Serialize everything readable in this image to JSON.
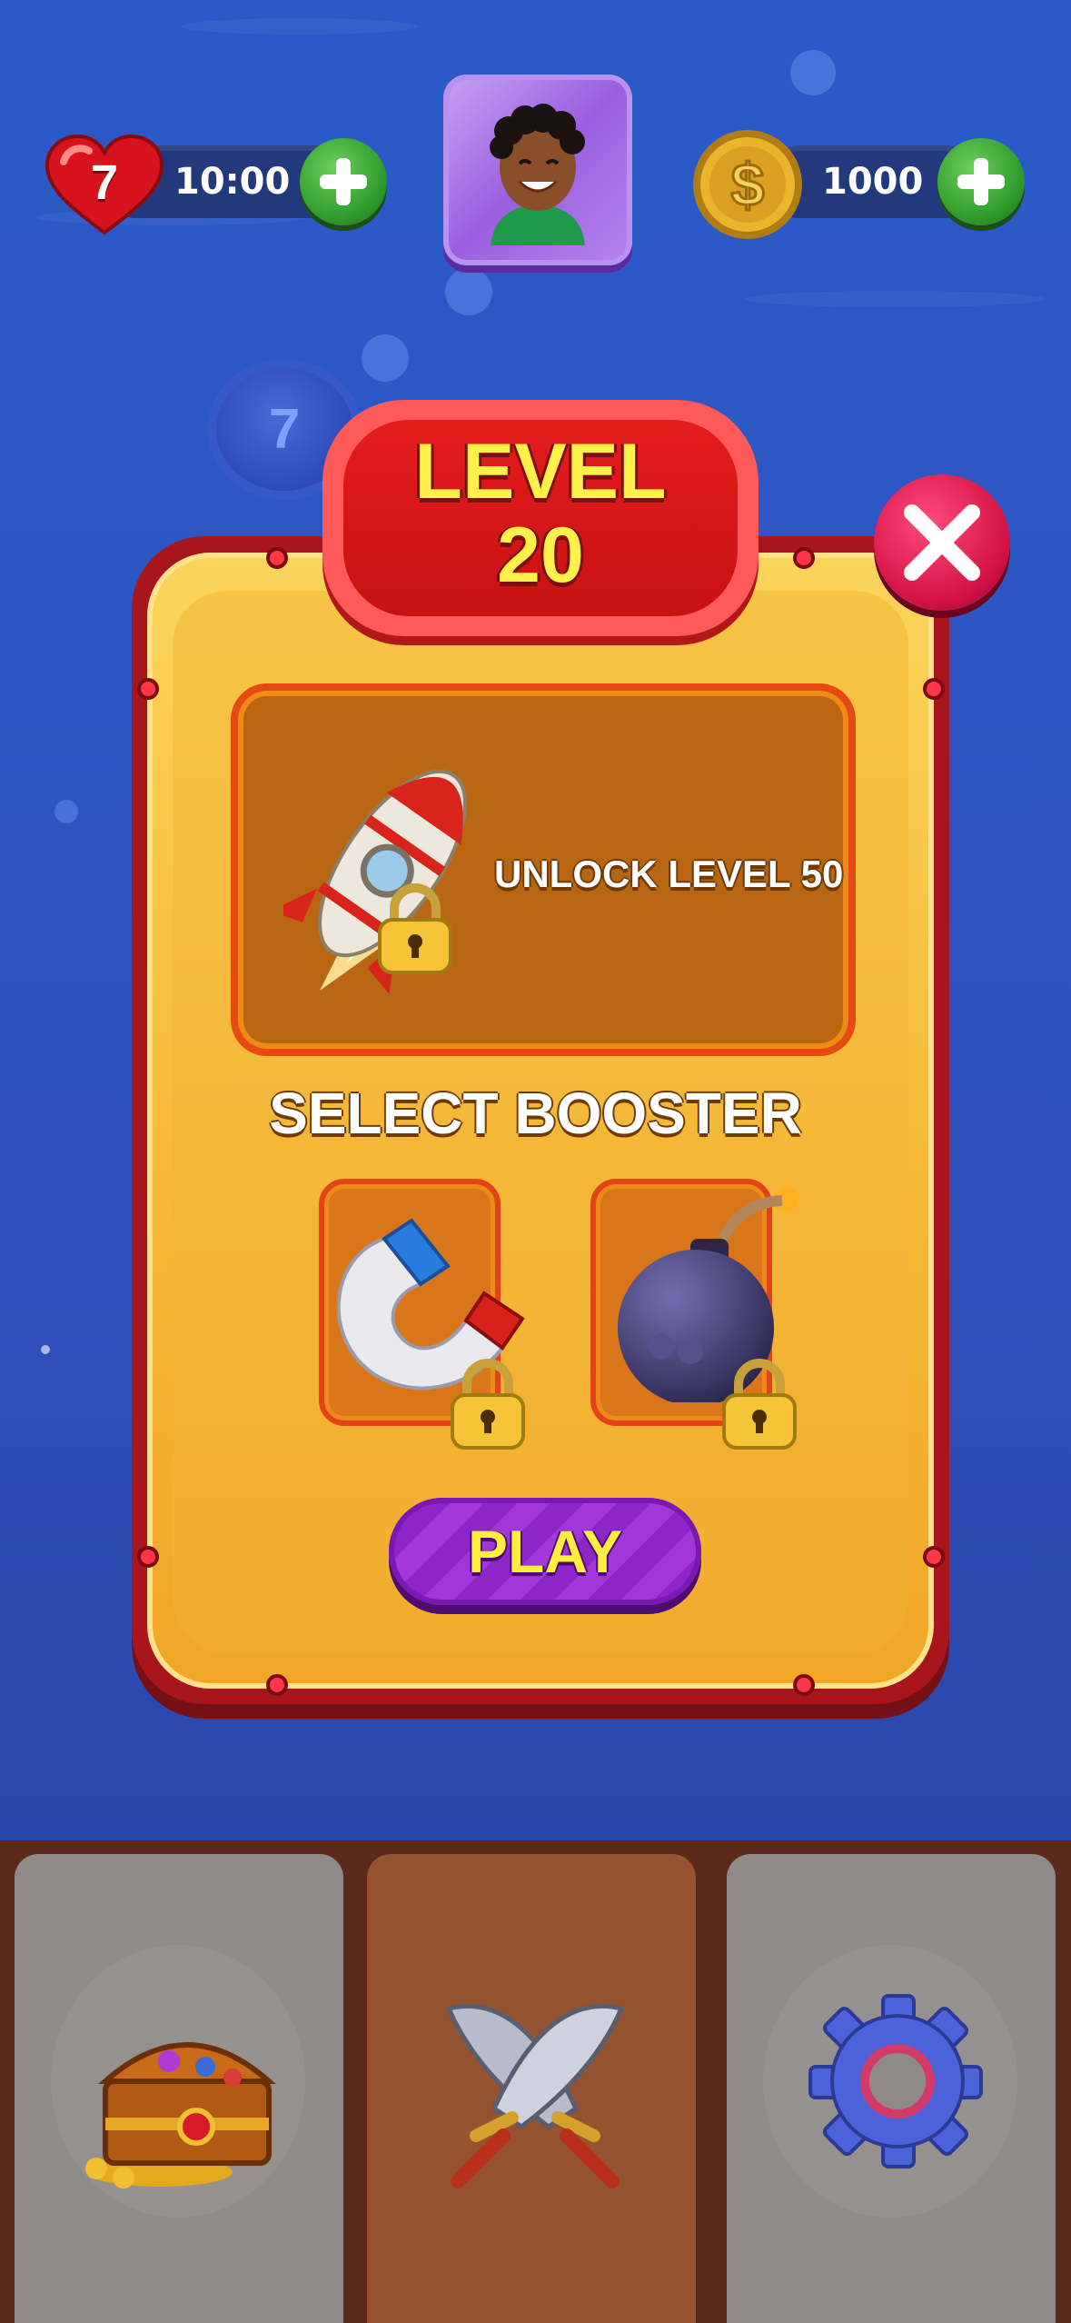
{
  "hud": {
    "lives": "7",
    "life_timer": "10:00",
    "coins": "1000"
  },
  "map_node": {
    "number": "7"
  },
  "dialog": {
    "level_word": "LEVEL",
    "level_number": "20",
    "reward_text": "UNLOCK LEVEL 50",
    "booster_title": "SELECT BOOSTER",
    "play_label": "PLAY"
  },
  "boosters": [
    {
      "icon": "magnet-icon",
      "locked": true
    },
    {
      "icon": "bomb-icon",
      "locked": true
    }
  ],
  "nav": {
    "tabs": [
      {
        "icon": "treasure-chest-icon",
        "active": false
      },
      {
        "icon": "crossed-swords-icon",
        "active": true
      },
      {
        "icon": "gear-icon",
        "active": false
      }
    ]
  },
  "colors": {
    "background": "#2d56c2",
    "board": "#f6b937",
    "badge": "#e51c1c",
    "play_button": "#a136d9",
    "level_text": "#fff14a"
  }
}
